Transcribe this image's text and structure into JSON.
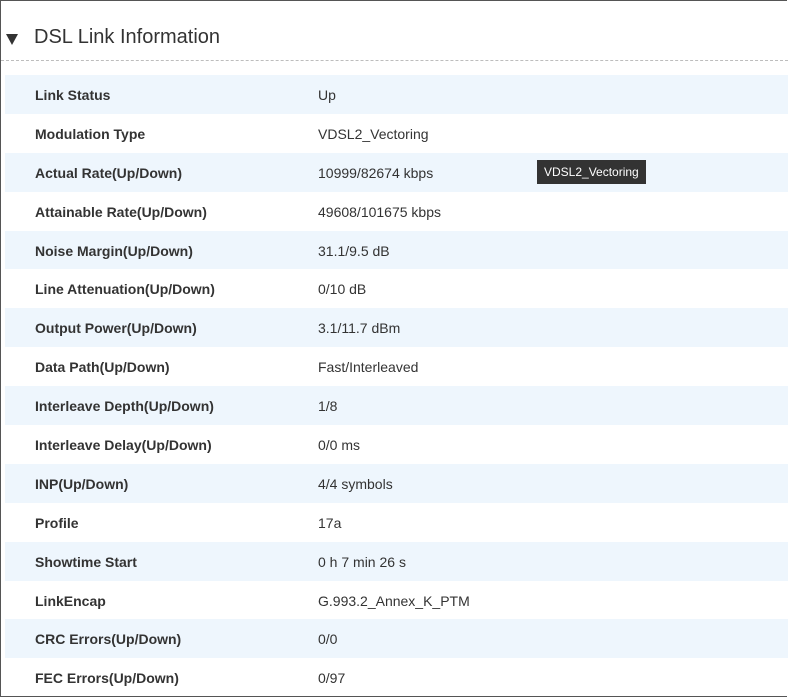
{
  "section": {
    "title": "DSL Link Information"
  },
  "tooltip": {
    "text": "VDSL2_Vectoring"
  },
  "rows": [
    {
      "label": "Link Status",
      "value": "Up"
    },
    {
      "label": "Modulation Type",
      "value": "VDSL2_Vectoring"
    },
    {
      "label": "Actual Rate(Up/Down)",
      "value": "10999/82674 kbps"
    },
    {
      "label": "Attainable Rate(Up/Down)",
      "value": "49608/101675 kbps"
    },
    {
      "label": "Noise Margin(Up/Down)",
      "value": "31.1/9.5 dB"
    },
    {
      "label": "Line Attenuation(Up/Down)",
      "value": "0/10 dB"
    },
    {
      "label": "Output Power(Up/Down)",
      "value": "3.1/11.7 dBm"
    },
    {
      "label": "Data Path(Up/Down)",
      "value": "Fast/Interleaved"
    },
    {
      "label": "Interleave Depth(Up/Down)",
      "value": "1/8"
    },
    {
      "label": "Interleave Delay(Up/Down)",
      "value": "0/0 ms"
    },
    {
      "label": "INP(Up/Down)",
      "value": "4/4 symbols"
    },
    {
      "label": "Profile",
      "value": "17a"
    },
    {
      "label": "Showtime Start",
      "value": "0 h 7 min 26 s"
    },
    {
      "label": "LinkEncap",
      "value": "G.993.2_Annex_K_PTM"
    },
    {
      "label": "CRC Errors(Up/Down)",
      "value": "0/0"
    },
    {
      "label": "FEC Errors(Up/Down)",
      "value": "0/97"
    }
  ],
  "colors": {
    "row_shaded": "#eef6fd",
    "text": "#333333",
    "tooltip_bg": "#333333"
  }
}
